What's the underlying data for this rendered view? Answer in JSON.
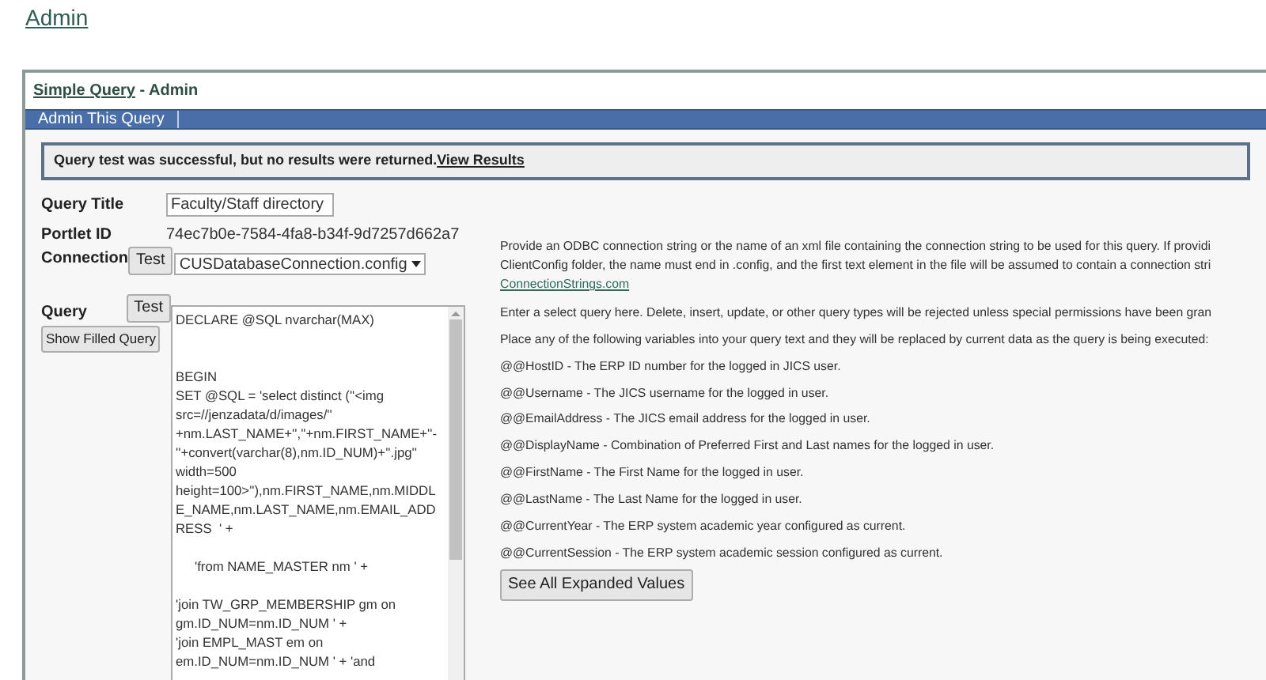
{
  "page_link": "Admin",
  "portlet": {
    "title_link": "Simple Query",
    "title_suffix": " - Admin",
    "tabs": [
      {
        "label": "Admin This Query",
        "selected": true
      }
    ],
    "message": {
      "text": "Query test was successful, but no results were returned.",
      "link": "View Results"
    },
    "form": {
      "query_title": {
        "label": "Query Title",
        "value": "Faculty/Staff directory"
      },
      "portlet_id": {
        "label": "Portlet ID",
        "value": "74ec7b0e-7584-4fa8-b34f-9d7257d662a7"
      },
      "connection": {
        "label": "Connection",
        "test_button": "Test",
        "value": "CUSDatabaseConnection.config"
      },
      "query": {
        "label": "Query",
        "test_button": "Test",
        "show_button": "Show Filled Query",
        "blocks": [
          {
            "indented": false,
            "lines": [
              "DECLARE @SQL nvarchar(MAX)"
            ]
          },
          {
            "indented": false,
            "lines": [
              "BEGIN",
              "SET @SQL = 'select distinct (''<img",
              "src=//jenzadata/d/images/''",
              "+nm.LAST_NAME+'',''+nm.FIRST_NAME+''-",
              "''+convert(varchar(8),nm.ID_NUM)+''.jpg''",
              "width=500",
              "height=100>''),nm.FIRST_NAME,nm.MIDDL",
              "E_NAME,nm.LAST_NAME,nm.EMAIL_ADD",
              "RESS  ' +"
            ]
          },
          {
            "indented": true,
            "lines": [
              "'from NAME_MASTER nm ' +"
            ]
          },
          {
            "indented": false,
            "lines": [
              "'join TW_GRP_MEMBERSHIP gm on",
              "gm.ID_NUM=nm.ID_NUM ' +",
              "'join EMPL_MAST em on",
              "em.ID_NUM=nm.ID_NUM ' + 'and"
            ]
          }
        ]
      }
    },
    "help": {
      "connection_lines": [
        "Provide an ODBC connection string or the name of an xml file containing the connection string to be used for this query. If providi",
        "ClientConfig folder, the name must end in .config, and the first text element in the file will be assumed to contain a connection stri"
      ],
      "connection_link": "ConnectionStrings.com",
      "query_intro": "Enter a select query here. Delete, insert, update, or other query types will be rejected unless special permissions have been gran",
      "variables_intro": "Place any of the following variables into your query text and they will be replaced by current data as the query is being executed:",
      "variables": [
        "@@HostID - The ERP ID number for the logged in JICS user.",
        "@@Username - The JICS username for the logged in user.",
        "@@EmailAddress - The JICS email address for the logged in user.",
        "@@DisplayName - Combination of Preferred First and Last names for the logged in user.",
        "@@FirstName - The First Name for the logged in user.",
        "@@LastName - The Last Name for the logged in user.",
        "@@CurrentYear - The ERP system academic year configured as current.",
        "@@CurrentSession - The ERP system academic session configured as current."
      ],
      "expand_button": "See All Expanded Values"
    }
  }
}
